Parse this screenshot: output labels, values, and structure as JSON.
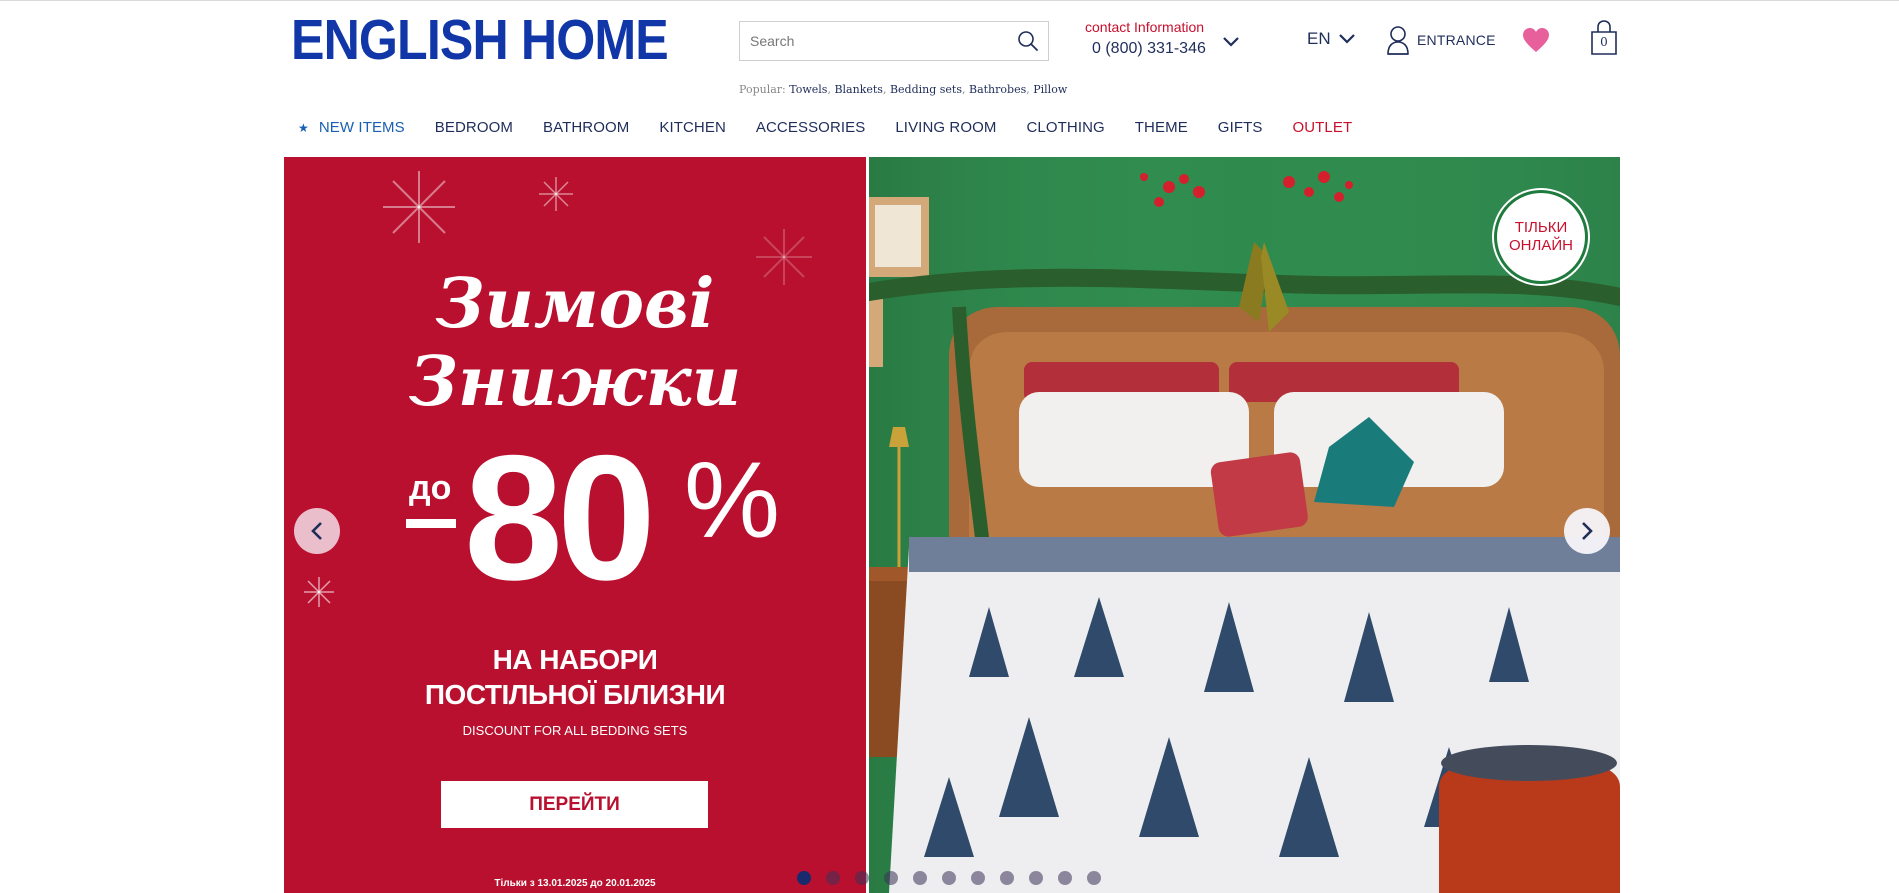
{
  "header": {
    "logo": "ENGLISH HOME",
    "search": {
      "placeholder": "Search",
      "icon": "search-icon"
    },
    "popular": {
      "label": "Popular:",
      "items": [
        "Towels",
        "Blankets",
        "Bedding sets",
        "Bathrobes",
        "Pillow"
      ]
    },
    "contact": {
      "label": "contact Information",
      "phone": "0 (800) 331-346"
    },
    "language": "EN",
    "entrance": "ENTRANCE",
    "cart_count": "0"
  },
  "nav": {
    "items": [
      {
        "label": "NEW ITEMS"
      },
      {
        "label": "BEDROOM"
      },
      {
        "label": "BATHROOM"
      },
      {
        "label": "KITCHEN"
      },
      {
        "label": "ACCESSORIES"
      },
      {
        "label": "LIVING ROOM"
      },
      {
        "label": "CLOTHING"
      },
      {
        "label": "THEME"
      },
      {
        "label": "GIFTS"
      },
      {
        "label": "OUTLET"
      }
    ]
  },
  "banner": {
    "headline_1": "Зимові",
    "headline_2": "Знижки",
    "prefix": "до",
    "discount_number": "80",
    "percent": "%",
    "subline_1": "НА НАБОРИ",
    "subline_2": "ПОСТІЛЬНОЇ БІЛИЗНИ",
    "small": "DISCOUNT FOR ALL BEDDING SETS",
    "cta": "ПЕРЕЙТИ",
    "dates": "Тільки з 13.01.2025 до 20.01.2025",
    "badge_1": "ТІЛЬКИ",
    "badge_2": "ОНЛАЙН",
    "slide_count": 11,
    "active_slide": 1
  },
  "colors": {
    "brand_blue": "#1136a8",
    "promo_red": "#b8102e",
    "outlet_red": "#c8102e",
    "nav_text": "#1f2d5a",
    "heart_pink": "#e8609b"
  }
}
